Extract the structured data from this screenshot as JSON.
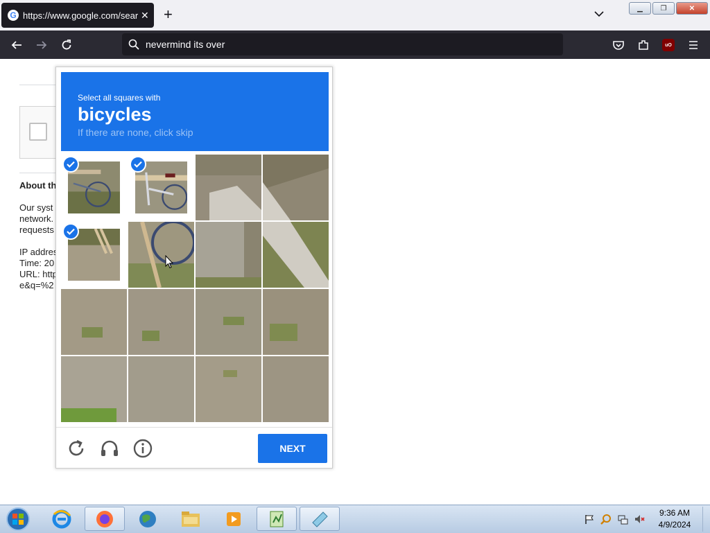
{
  "browser": {
    "tab": {
      "title": "https://www.google.com/search",
      "favicon": "G"
    },
    "new_tab": "+",
    "url": "nevermind its over",
    "ublock_badge": "uO"
  },
  "background_page": {
    "heading": "About th",
    "paragraph_lines": [
      "Our syst",
      "network.",
      "requests"
    ],
    "info_lines": [
      "IP addres",
      "Time: 20",
      "URL: http",
      "e&q=%2"
    ]
  },
  "captcha": {
    "instruction": "Select all squares with",
    "keyword": "bicycles",
    "hint": "If there are none, click skip",
    "selected_tiles": [
      0,
      1,
      4
    ],
    "next_label": "NEXT",
    "colors": {
      "accent": "#1a73e8"
    }
  },
  "taskbar": {
    "apps": [
      "internet-explorer",
      "firefox",
      "chrome-like-globe",
      "file-explorer",
      "media-player",
      "notepad-plus",
      "notebook-app"
    ],
    "time": "9:36 AM",
    "date": "4/9/2024"
  }
}
